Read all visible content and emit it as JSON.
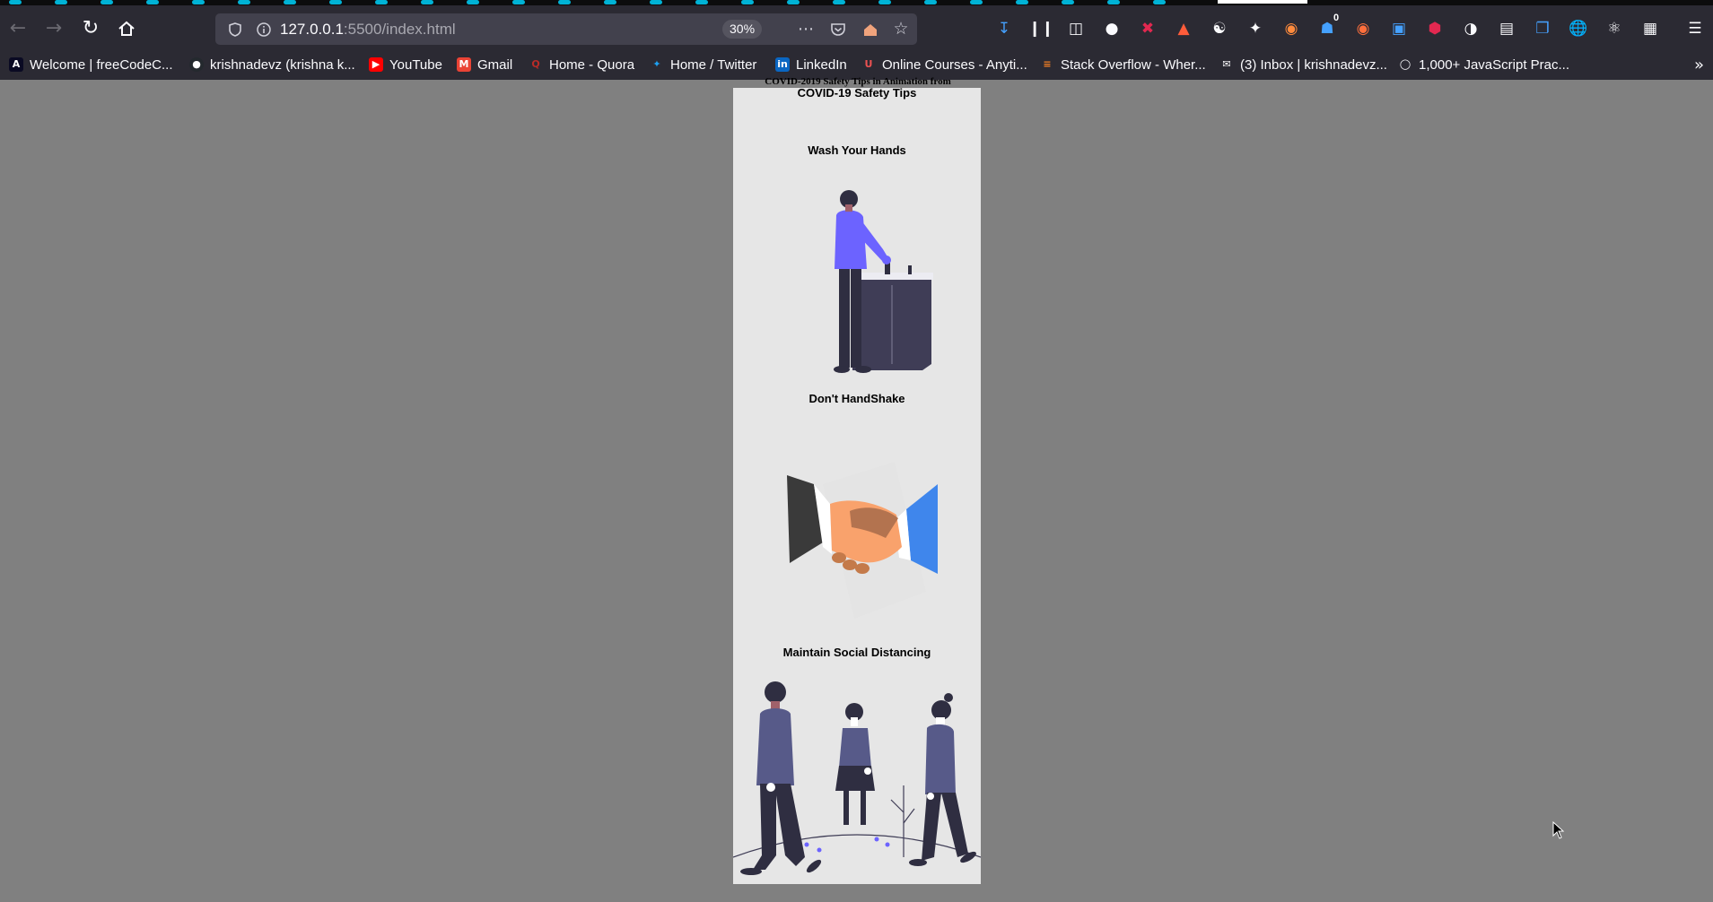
{
  "browser": {
    "url_host": "127.0.0.1",
    "url_path": ":5500/index.html",
    "zoom_level": "30%",
    "notification_count": "0",
    "icons": {
      "back": "back-arrow-icon",
      "forward": "forward-arrow-icon",
      "reload": "reload-icon",
      "home": "home-icon",
      "shield": "tracking-protection-icon",
      "info": "site-info-icon",
      "more": "more-actions-icon",
      "pocket": "pocket-icon",
      "star": "bookmark-star-icon",
      "menu": "hamburger-menu-icon"
    },
    "accent_color": "#00b3d6"
  },
  "bookmarks": [
    {
      "label": "Welcome | freeCodeC...",
      "icon": "freecodecamp-icon"
    },
    {
      "label": "krishnadevz (krishna k...",
      "icon": "github-icon"
    },
    {
      "label": "YouTube",
      "icon": "youtube-icon"
    },
    {
      "label": "Gmail",
      "icon": "gmail-icon"
    },
    {
      "label": "Home - Quora",
      "icon": "quora-icon"
    },
    {
      "label": "Home / Twitter",
      "icon": "twitter-icon"
    },
    {
      "label": "LinkedIn",
      "icon": "linkedin-icon"
    },
    {
      "label": "Online Courses - Anyti...",
      "icon": "udemy-icon"
    },
    {
      "label": "Stack Overflow - Wher...",
      "icon": "stackoverflow-icon"
    },
    {
      "label": "(3) Inbox | krishnadevz...",
      "icon": "inbox-icon"
    },
    {
      "label": "1,000+ JavaScript Prac...",
      "icon": "globe-icon"
    }
  ],
  "page": {
    "heading": "COVID-2019 Safety Tips in Animation from",
    "subtitle": "COVID-19 Safety Tips",
    "tips": [
      {
        "title": "Wash Your Hands",
        "illustration": "person-washing-hands-illustration"
      },
      {
        "title": "Don't  HandShake",
        "illustration": "handshake-illustration"
      },
      {
        "title": "Maintain Social Distancing",
        "illustration": "social-distancing-illustration"
      }
    ],
    "background_color": "#808080",
    "card_color": "#e6e6e6"
  }
}
